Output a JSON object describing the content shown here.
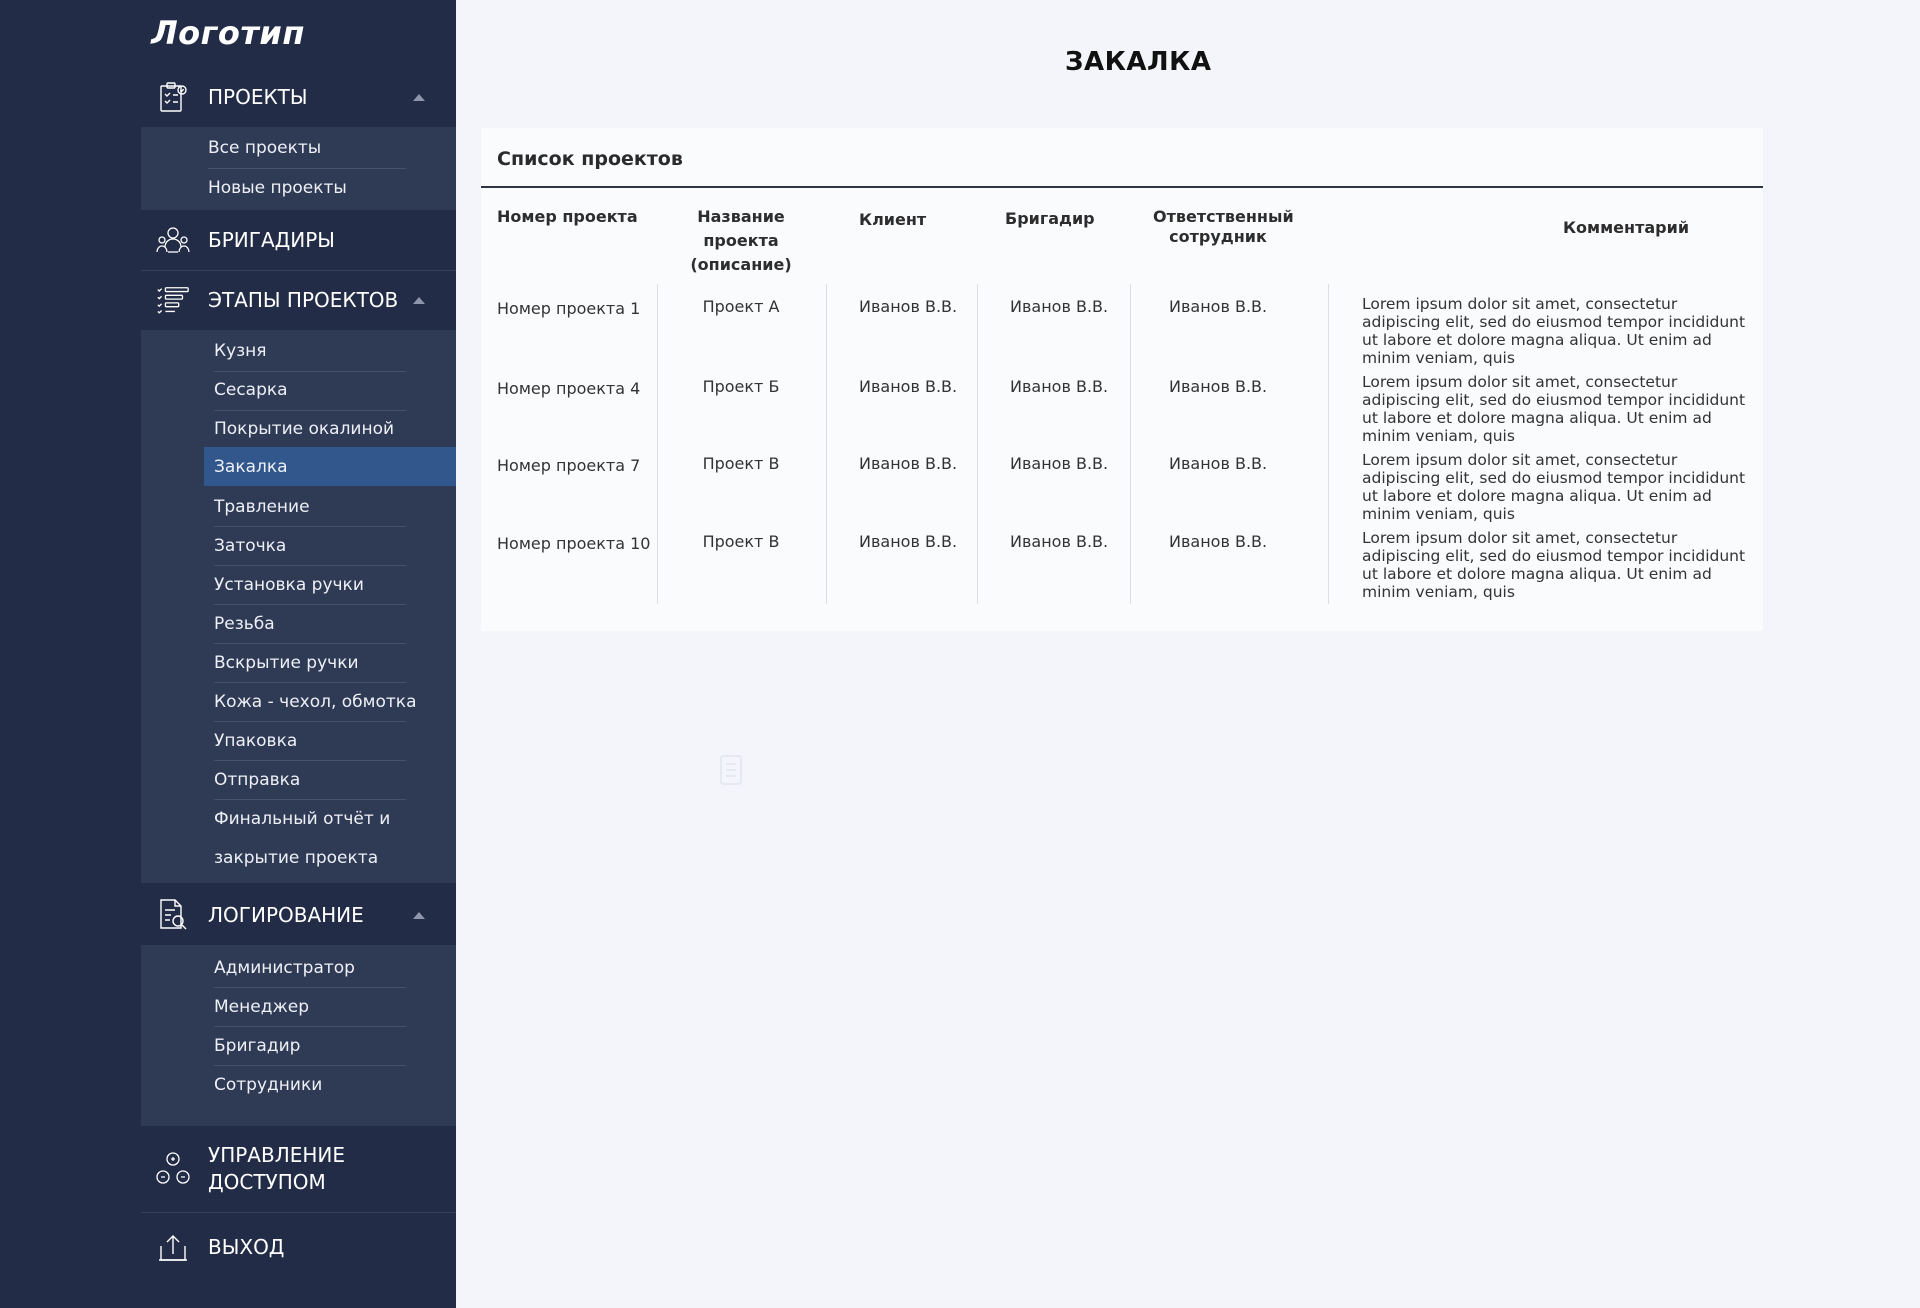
{
  "sidebar": {
    "logo": "Логотип",
    "projects": {
      "title": "ПРОЕКТЫ",
      "icon": "clipboard-icon",
      "items": [
        "Все проекты",
        "Новые проекты"
      ]
    },
    "foremen": {
      "title": "БРИГАДИРЫ",
      "icon": "team-icon"
    },
    "stages": {
      "title": "ЭТАПЫ ПРОЕКТОВ",
      "icon": "checklist-icon",
      "items": [
        "Кузня",
        "Сесарка",
        "Покрытие окалиной",
        "Закалка",
        "Травление",
        "Заточка",
        "Установка ручки",
        "Резьба",
        "Вскрытие ручки",
        "Кожа - чехол, обмотка",
        "Упаковка",
        "Отправка",
        "Финальный отчёт и",
        "закрытие проекта"
      ],
      "active": "Закалка"
    },
    "logging": {
      "title": "ЛОГИРОВАНИЕ",
      "icon": "log-search-icon",
      "items": [
        "Администратор",
        "Менеджер",
        "Бригадир",
        "Сотрудники"
      ]
    },
    "access": {
      "title_line1": "УПРАВЛЕНИЕ",
      "title_line2": "ДОСТУПОМ",
      "icon": "access-icon"
    },
    "logout": {
      "title": "ВЫХОД",
      "icon": "logout-icon"
    }
  },
  "main": {
    "title": "ЗАКАЛКА",
    "card_title": "Список проектов",
    "columns": {
      "number": "Номер проекта",
      "name_line1": "Название проекта",
      "name_line2": "(описание)",
      "client": "Клиент",
      "foreman": "Бригадир",
      "responsible_line1": "Ответственный",
      "responsible_line2": "сотрудник",
      "comment": "Комментарий"
    },
    "rows": [
      {
        "number": "Номер проекта 1",
        "name": "Проект А",
        "client": "Иванов В.В.",
        "foreman": "Иванов В.В.",
        "responsible": "Иванов В.В.",
        "comment": "Lorem ipsum dolor sit amet, consectetur adipiscing elit, sed do eiusmod tempor incididunt ut labore et dolore magna aliqua. Ut enim ad minim veniam, quis"
      },
      {
        "number": "Номер проекта 4",
        "name": "Проект Б",
        "client": "Иванов В.В.",
        "foreman": "Иванов В.В.",
        "responsible": "Иванов В.В.",
        "comment": "Lorem ipsum dolor sit amet, consectetur adipiscing elit, sed do eiusmod tempor incididunt ut labore et dolore magna aliqua. Ut enim ad minim veniam, quis"
      },
      {
        "number": "Номер проекта 7",
        "name": "Проект В",
        "client": "Иванов В.В.",
        "foreman": "Иванов В.В.",
        "responsible": "Иванов В.В.",
        "comment": "Lorem ipsum dolor sit amet, consectetur adipiscing elit, sed do eiusmod tempor incididunt ut labore et dolore magna aliqua. Ut enim ad minim veniam, quis"
      },
      {
        "number": "Номер проекта 10",
        "name": "Проект В",
        "client": "Иванов В.В.",
        "foreman": "Иванов В.В.",
        "responsible": "Иванов В.В.",
        "comment": "Lorem ipsum dolor sit amet, consectetur adipiscing elit, sed do eiusmod tempor incididunt ut labore et dolore magna aliqua. Ut enim ad minim veniam, quis"
      }
    ]
  }
}
